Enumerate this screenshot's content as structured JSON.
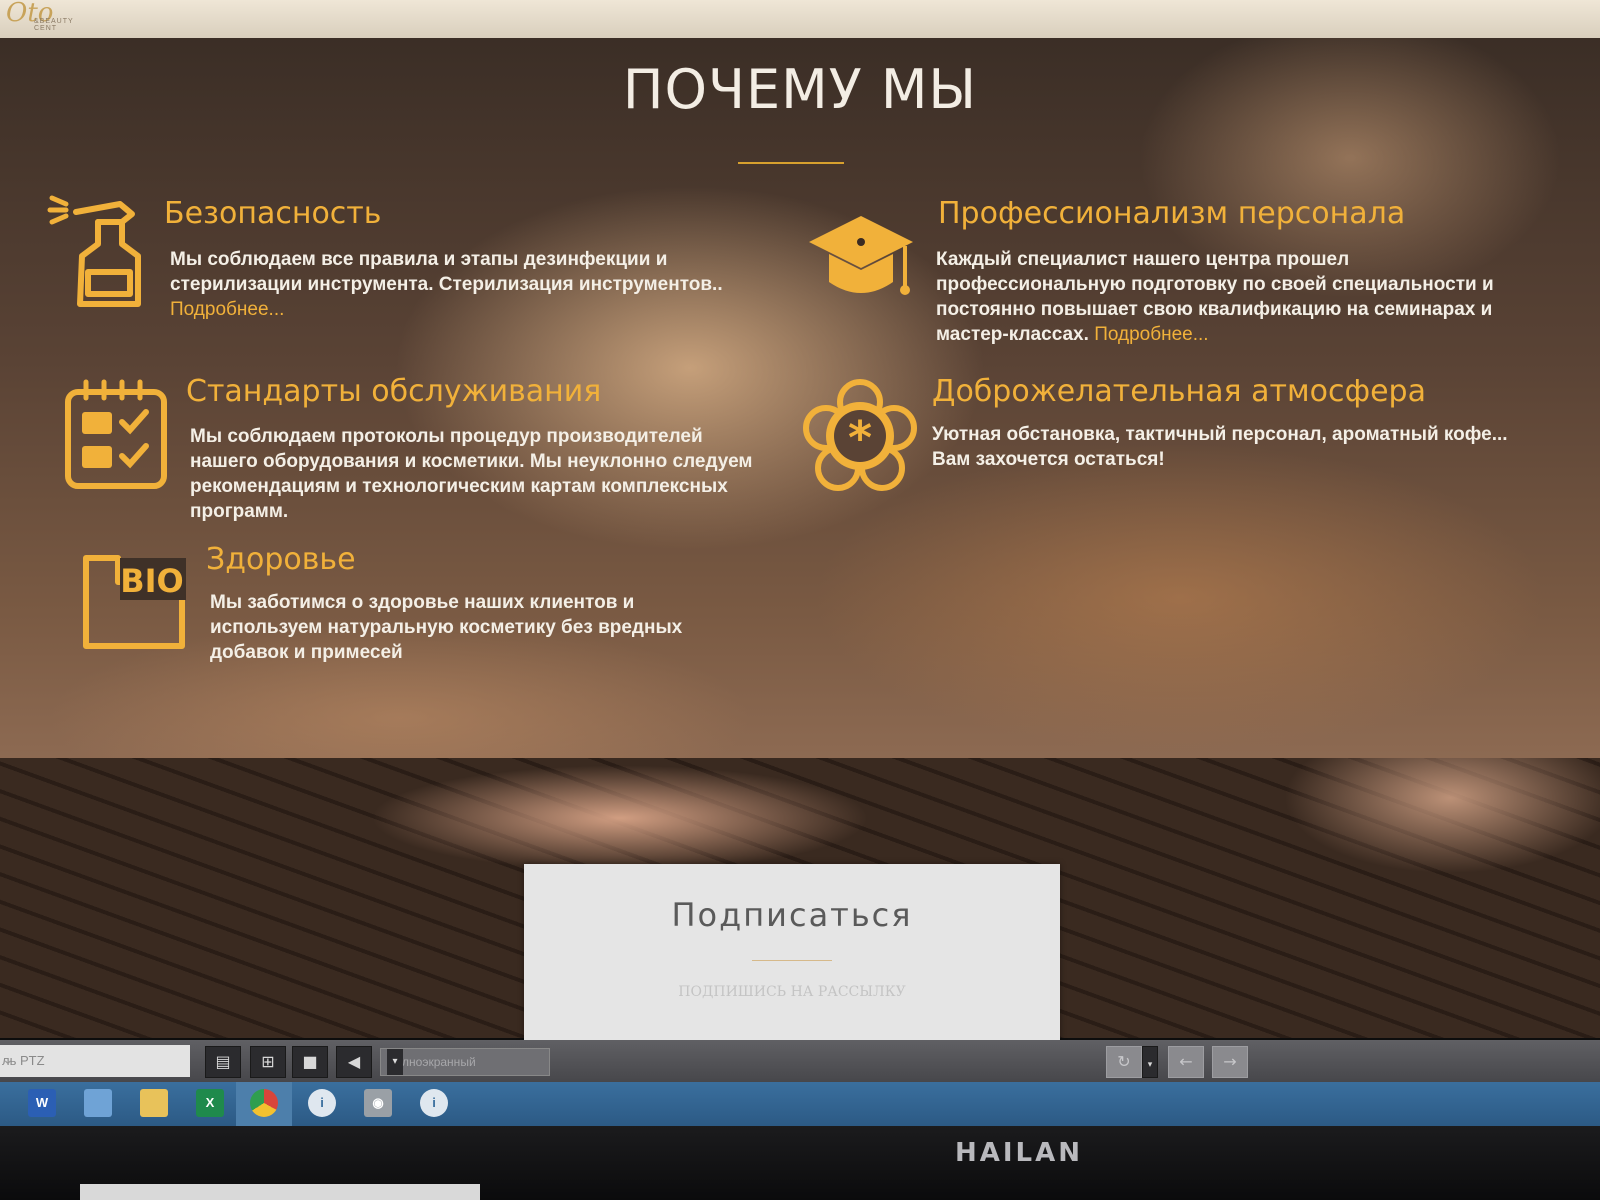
{
  "site": {
    "logo_text": "Oto",
    "logo_sub": "&BEAUTY CENT"
  },
  "why_us": {
    "title": "ПОЧЕМУ МЫ",
    "accent_color": "#f1b13a",
    "features": [
      {
        "icon": "spray-bottle-icon",
        "title": "Безопасность",
        "text": "Мы соблюдаем все правила и этапы дезинфекции и стерилизации инструмента. Стерилизация инструментов..",
        "more": "Подробнее..."
      },
      {
        "icon": "graduation-cap-icon",
        "title": "Профессионализм персонала",
        "text": "Каждый специалист нашего центра прошел профессиональную подготовку по своей специальности и постоянно повышает свою квалификацию на семинарах и мастер-классах.",
        "more": "Подробнее..."
      },
      {
        "icon": "checklist-calendar-icon",
        "title": "Стандарты обслуживания",
        "text": "Мы соблюдаем протоколы процедур производителей нашего оборудования и косметики. Мы неуклонно следуем рекомендациям и технологическим картам комплексных программ."
      },
      {
        "icon": "flower-icon",
        "title": "Доброжелательная атмосфера",
        "text": "Уютная обстановка, тактичный персонал, ароматный кофе... Вам захочется остаться!"
      },
      {
        "icon": "bio-icon",
        "icon_text": "BIO",
        "title": "Здоровье",
        "text": "Мы заботимся о здоровье наших клиентов и используем натуральную косметику без вредных добавок и примесей"
      }
    ]
  },
  "subscribe": {
    "title": "Подписаться",
    "subtitle": "ПОДПИШИСЬ НА РАССЫЛКУ"
  },
  "viewer_toolbar": {
    "ptz_label": "ль PTZ",
    "view_mode": "Полноэкранный",
    "buttons": [
      "layout-single-icon",
      "layout-grid-icon",
      "stop-icon",
      "mute-icon",
      "refresh-icon",
      "back-arrow-icon",
      "forward-arrow-icon"
    ]
  },
  "taskbar": {
    "apps": [
      "word-icon",
      "computer-icon",
      "folder-icon",
      "excel-icon",
      "chrome-icon",
      "info-icon",
      "camera-icon",
      "info-icon"
    ],
    "word_letter": "W",
    "excel_letter": "X"
  },
  "monitor": {
    "brand": "HAILAN"
  }
}
